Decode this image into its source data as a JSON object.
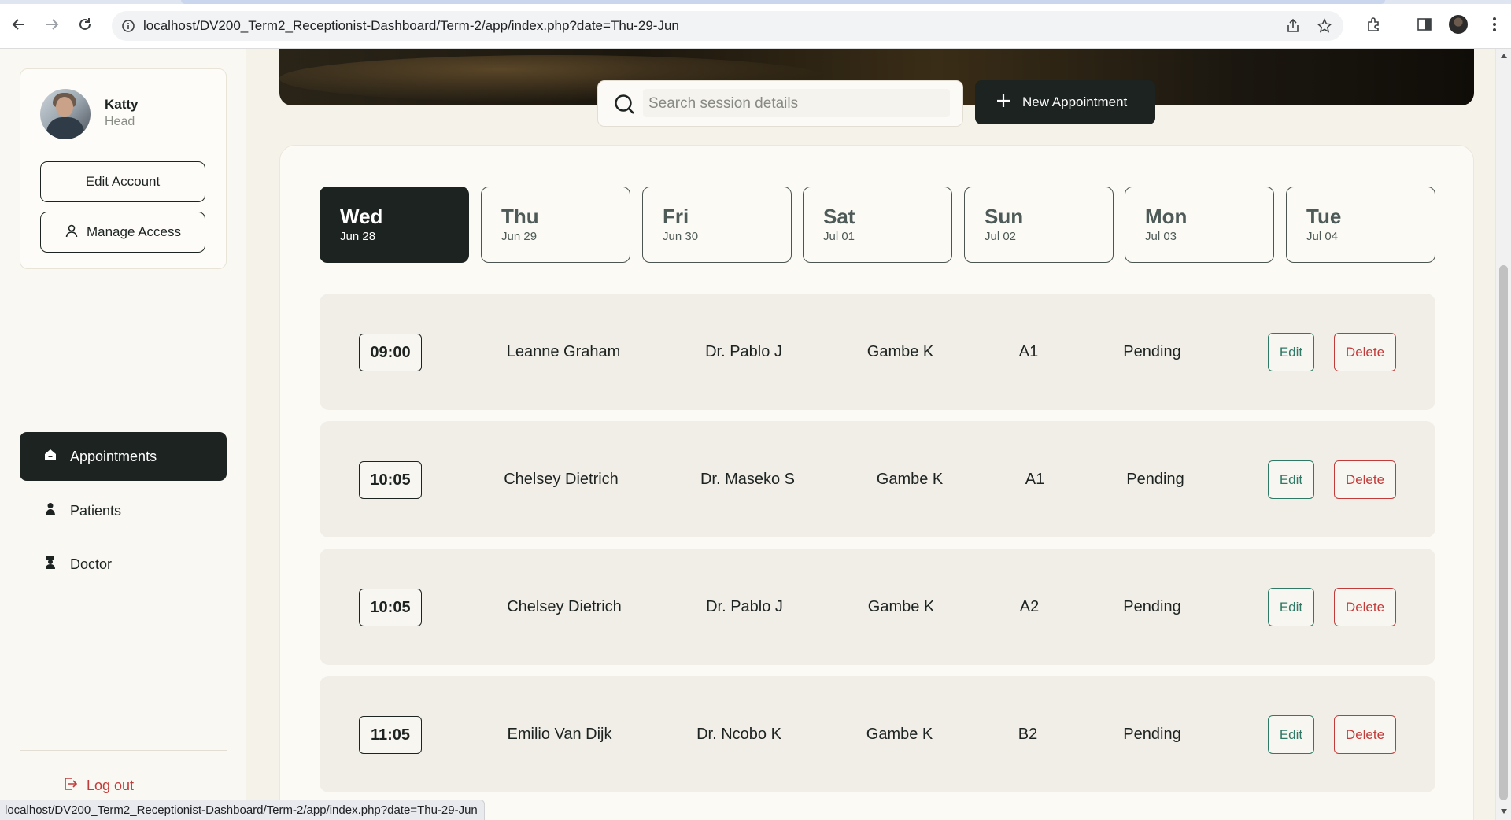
{
  "browser": {
    "url": "localhost/DV200_Term2_Receptionist-Dashboard/Term-2/app/index.php?date=Thu-29-Jun",
    "icons": [
      "back-icon",
      "forward-icon",
      "reload-icon",
      "site-info-icon",
      "share-icon",
      "star-icon",
      "extensions-icon",
      "side-panel-icon",
      "profile-avatar-icon",
      "menu-icon"
    ]
  },
  "sidebar": {
    "profile": {
      "name": "Katty",
      "role": "Head"
    },
    "edit_account_label": "Edit Account",
    "manage_access_label": "Manage Access",
    "menu": [
      {
        "label": "Appointments",
        "icon": "home-icon",
        "active": true
      },
      {
        "label": "Patients",
        "icon": "patient-icon",
        "active": false
      },
      {
        "label": "Doctor",
        "icon": "doctor-icon",
        "active": false
      }
    ],
    "logout_label": "Log out"
  },
  "search": {
    "placeholder": "Search session details"
  },
  "new_appointment_label": "New Appointment",
  "days": [
    {
      "name": "Wed",
      "date": "Jun 28",
      "active": true
    },
    {
      "name": "Thu",
      "date": "Jun 29",
      "active": false
    },
    {
      "name": "Fri",
      "date": "Jun 30",
      "active": false
    },
    {
      "name": "Sat",
      "date": "Jul 01",
      "active": false
    },
    {
      "name": "Sun",
      "date": "Jul 02",
      "active": false
    },
    {
      "name": "Mon",
      "date": "Jul 03",
      "active": false
    },
    {
      "name": "Tue",
      "date": "Jul 04",
      "active": false
    }
  ],
  "appointments": [
    {
      "time": "09:00",
      "patient": "Leanne Graham",
      "doctor": "Dr. Pablo J",
      "receptionist": "Gambe K",
      "room": "A1",
      "status": "Pending"
    },
    {
      "time": "10:05",
      "patient": "Chelsey Dietrich",
      "doctor": "Dr. Maseko S",
      "receptionist": "Gambe K",
      "room": "A1",
      "status": "Pending"
    },
    {
      "time": "10:05",
      "patient": "Chelsey Dietrich",
      "doctor": "Dr. Pablo J",
      "receptionist": "Gambe K",
      "room": "A2",
      "status": "Pending"
    },
    {
      "time": "11:05",
      "patient": "Emilio Van Dijk",
      "doctor": "Dr. Ncobo K",
      "receptionist": "Gambe K",
      "room": "B2",
      "status": "Pending"
    }
  ],
  "row_actions": {
    "edit_label": "Edit",
    "delete_label": "Delete"
  },
  "status_bar_url": "localhost/DV200_Term2_Receptionist-Dashboard/Term-2/app/index.php?date=Thu-29-Jun",
  "colors": {
    "dark": "#1c2321",
    "accent_edit": "#2e7a66",
    "danger": "#c23b3b",
    "background": "#f5f2ea"
  }
}
